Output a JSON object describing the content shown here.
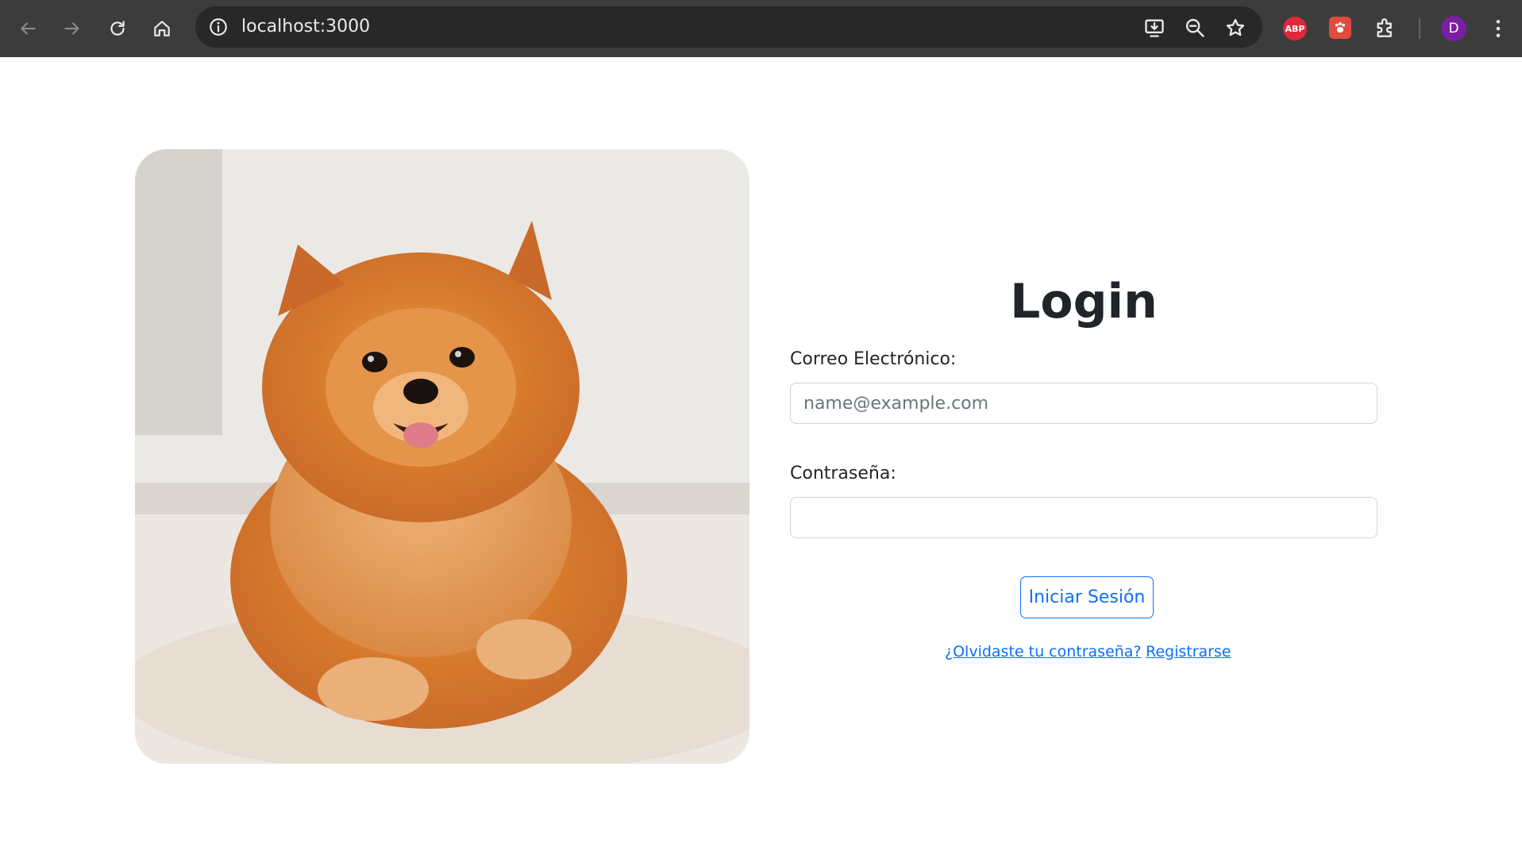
{
  "browser": {
    "url": "localhost:3000",
    "extensions": {
      "adblock_label": "ABP",
      "profile_initial": "D"
    },
    "colors": {
      "toolbar": "#3c3c3c",
      "omnibox": "#282828",
      "icon": "#e8eaed",
      "icon_disabled": "#8a8a8a"
    }
  },
  "page": {
    "image_alt_icon": "pomeranian-dog-photo",
    "login": {
      "title": "Login",
      "email_label": "Correo Electrónico:",
      "email_placeholder": "name@example.com",
      "email_value": "",
      "password_label": "Contraseña:",
      "password_value": "",
      "submit_label": "Iniciar Sesión",
      "forgot_link": "¿Olvidaste tu contraseña?",
      "register_link": "Registrarse"
    },
    "colors": {
      "primary": "#0d6efd",
      "text": "#212529",
      "border": "#ced4da"
    }
  }
}
